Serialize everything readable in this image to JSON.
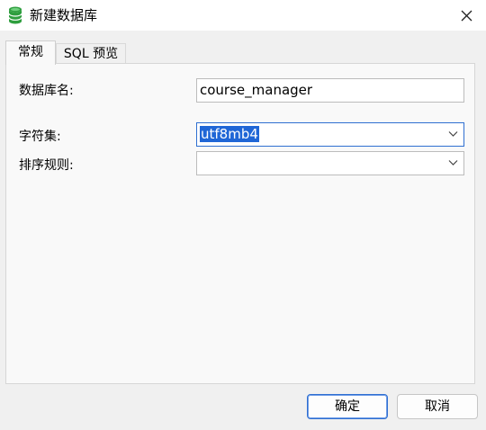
{
  "window": {
    "title": "新建数据库",
    "icon": "database-icon",
    "close_icon": "close-icon"
  },
  "tabs": [
    {
      "label": "常规",
      "active": true
    },
    {
      "label": "SQL 预览",
      "active": false
    }
  ],
  "form": {
    "db_name_label": "数据库名:",
    "db_name_value": "course_manager",
    "charset_label": "字符集:",
    "charset_value": "utf8mb4",
    "collation_label": "排序规则:",
    "collation_value": ""
  },
  "buttons": {
    "ok_label": "确定",
    "cancel_label": "取消"
  },
  "colors": {
    "accent": "#1f66d6",
    "icon_green": "#2e9e3e"
  }
}
